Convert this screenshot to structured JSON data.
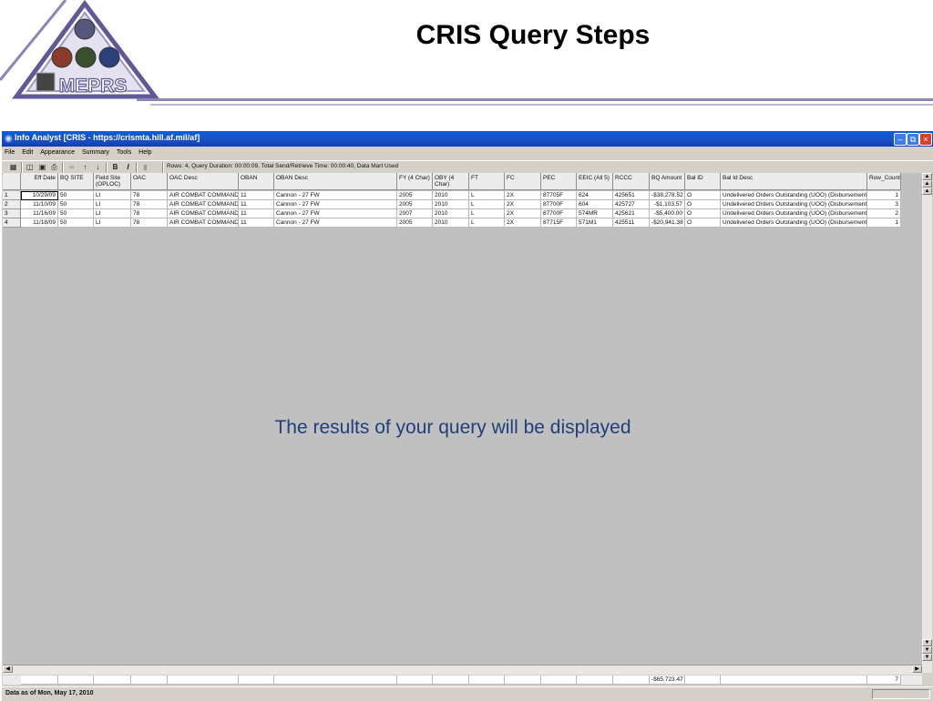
{
  "slide": {
    "title": "CRIS Query Steps",
    "logo_text": "MEPRS",
    "overlay_caption": "The results of your query will be displayed"
  },
  "window": {
    "title": "Info Analyst [CRIS - https://crismta.hill.af.mil/af]",
    "menu": [
      "File",
      "Edit",
      "Appearance",
      "Summary",
      "Tools",
      "Help"
    ],
    "toolbar_status": "Rows: 4, Query Duration: 00:00:09, Total Send/Retrieve Time: 00:00:40, Data Mart Used",
    "controls": [
      "minimize",
      "restore",
      "close"
    ]
  },
  "grid": {
    "columns": [
      "Eff Date",
      "BQ SITE",
      "Field Site (OPLOC)",
      "OAC",
      "OAC Desc",
      "OBAN",
      "OBAN Desc",
      "FY (4 Char)",
      "OBY (4 Char)",
      "FT",
      "FC",
      "PEC",
      "EEIC (All 5)",
      "RCCC",
      "BQ Amount",
      "Bal ID",
      "Bal Id Desc",
      "Row_Count"
    ],
    "rows": [
      {
        "num": "1",
        "cells": [
          "10/29/09",
          "50",
          "LI",
          "78",
          "AIR COMBAT COMMAND",
          "11",
          "Cannon - 27 FW",
          "2005",
          "2010",
          "L",
          "2X",
          "87705F",
          "624",
          "425651",
          "-$38,278.52",
          "O",
          "Undelivered Orders Outstanding (UOO) (Disbursement)",
          "1"
        ]
      },
      {
        "num": "2",
        "cells": [
          "11/10/09",
          "50",
          "LI",
          "78",
          "AIR COMBAT COMMAND",
          "11",
          "Cannon - 27 FW",
          "2005",
          "2010",
          "L",
          "2X",
          "87700F",
          "604",
          "425727",
          "-$1,103.57",
          "O",
          "Undelivered Orders Outstanding (UOO) (Disbursement)",
          "3"
        ]
      },
      {
        "num": "3",
        "cells": [
          "11/16/09",
          "50",
          "LI",
          "78",
          "AIR COMBAT COMMAND",
          "11",
          "Cannon - 27 FW",
          "2007",
          "2010",
          "L",
          "2X",
          "87700F",
          "574MR",
          "425621",
          "-$5,400.00",
          "O",
          "Undelivered Orders Outstanding (UOO) (Disbursement)",
          "2"
        ]
      },
      {
        "num": "4",
        "cells": [
          "11/18/09",
          "50",
          "LI",
          "78",
          "AIR COMBAT COMMAND",
          "11",
          "Cannon - 27 FW",
          "2005",
          "2010",
          "L",
          "2X",
          "87715F",
          "571M1",
          "425511",
          "-$20,941.38",
          "O",
          "Undelivered Orders Outstanding (UOO) (Disbursement)",
          "1"
        ]
      }
    ],
    "totals": {
      "bq_amount": "-$65,723.47",
      "row_count": "7"
    }
  },
  "status_bar": {
    "text": "Data as of Mon, May 17, 2010"
  },
  "colors": {
    "titlebar": "#0a5fd8",
    "slide_rule": "#8a86b8",
    "caption": "#1f3f7a",
    "grid_background": "#c0c0c0"
  },
  "icons": [
    "app-icon",
    "new-folder-icon",
    "open-icon",
    "save-icon",
    "print-icon",
    "binoculars-icon",
    "sort-ascending-icon",
    "sort-descending-icon",
    "bold-icon",
    "italic-icon",
    "columns-icon"
  ]
}
